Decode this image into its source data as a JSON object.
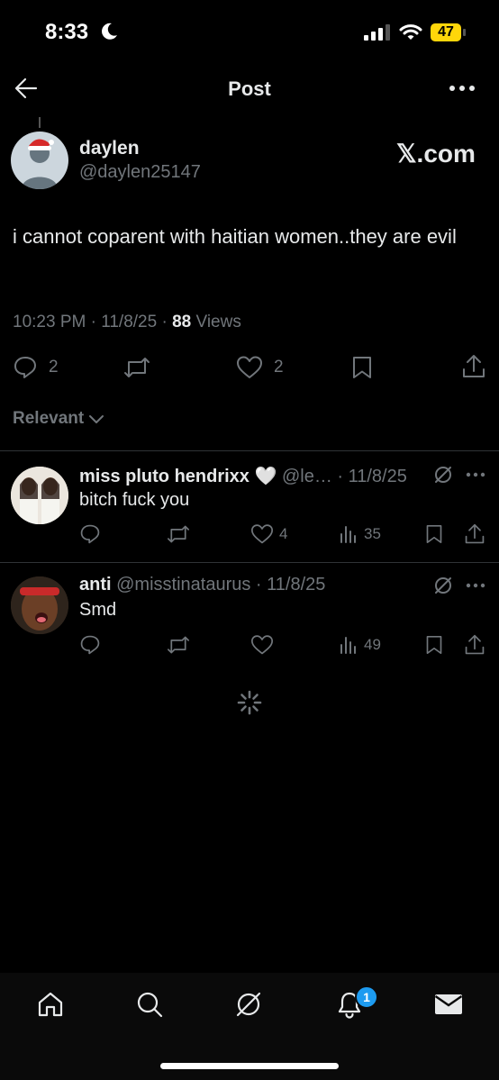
{
  "status_bar": {
    "time": "8:33",
    "battery": "47"
  },
  "header": {
    "title": "Post"
  },
  "post": {
    "name": "daylen",
    "handle": "@daylen25147",
    "source_badge": "𝕏.com",
    "text": "i cannot coparent with haitian women..they are evil",
    "meta_time": "10:23 PM · 11/8/25 · ",
    "views_count": "88",
    "views_label": " Views",
    "replies": "2",
    "likes": "2"
  },
  "sort": {
    "label": "Relevant"
  },
  "replies": [
    {
      "name": "miss pluto hendrixx 🤍",
      "handle_date": "@le… · 11/8/25",
      "text": "bitch fuck you",
      "likes": "4",
      "views": "35"
    },
    {
      "name": "anti",
      "handle_date": "@misstinataurus · 11/8/25",
      "text": "Smd",
      "likes": "",
      "views": "49"
    }
  ],
  "tab_bar": {
    "notification_count": "1"
  }
}
